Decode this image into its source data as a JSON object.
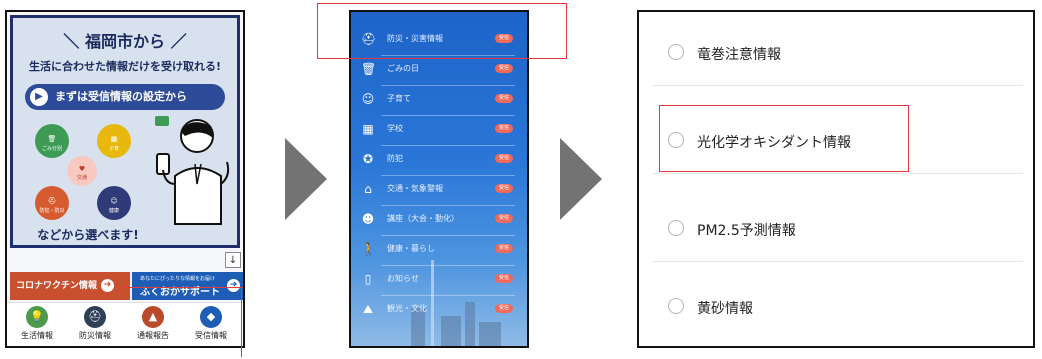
{
  "phone1": {
    "headline": "＼ 福岡市から ／",
    "subline": "生活に合わせた情報だけを受け取れる!",
    "setup_button": "まずは受信情報の設定から",
    "choose_text": "などから選べます!",
    "categories": [
      "ごみ分別",
      "子育",
      "交通",
      "防犯・防災",
      "健康"
    ],
    "corona_button": "コロナワクチン情報",
    "support_small": "あなたにぴったりな情報をお届け",
    "support_button": "ふくおかサポート",
    "nav": [
      {
        "label": "生活情報",
        "icon": "lightbulb-icon",
        "color": "#4c9a4c"
      },
      {
        "label": "防災情報",
        "icon": "helmet-icon",
        "color": "#2f3f55"
      },
      {
        "label": "通報報告",
        "icon": "cone-icon",
        "color": "#b94a2c"
      },
      {
        "label": "受信情報",
        "icon": "bell-icon",
        "color": "#1d5db6"
      }
    ]
  },
  "phone2": {
    "rows": [
      {
        "label": "防災・災害情報",
        "badge": "受信",
        "icon": "helmet-icon"
      },
      {
        "label": "ごみの日",
        "badge": "受信",
        "icon": "trash-icon"
      },
      {
        "label": "子育て",
        "badge": "受信",
        "icon": "child-icon"
      },
      {
        "label": "学校",
        "badge": "受信",
        "icon": "school-icon"
      },
      {
        "label": "防犯",
        "badge": "受信",
        "icon": "police-icon"
      },
      {
        "label": "交通・気象警報",
        "badge": "受信",
        "icon": "alert-icon"
      },
      {
        "label": "講座（大会・動化）",
        "badge": "受信",
        "icon": "people-icon"
      },
      {
        "label": "健康・暮らし",
        "badge": "受信",
        "icon": "walk-icon"
      },
      {
        "label": "お知らせ",
        "badge": "受信",
        "icon": "doc-icon"
      },
      {
        "label": "観光・文化",
        "badge": "受信",
        "icon": "mountain-icon"
      }
    ]
  },
  "phone3": {
    "rows": [
      {
        "label": "竜巻注意情報"
      },
      {
        "label": "光化学オキシダント情報"
      },
      {
        "label": "PM2.5予測情報"
      },
      {
        "label": "黄砂情報"
      }
    ]
  }
}
